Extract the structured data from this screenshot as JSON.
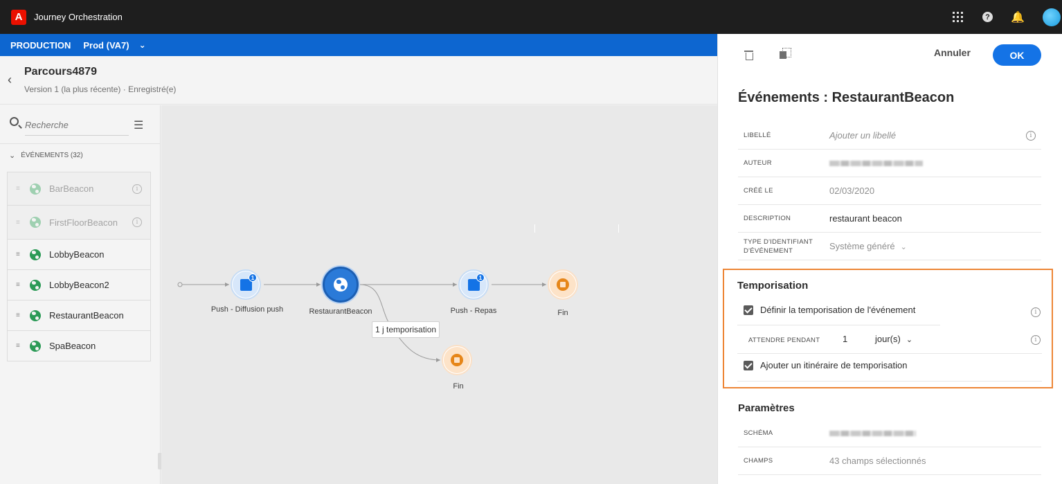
{
  "app": {
    "title": "Journey Orchestration",
    "logo_letter": "A"
  },
  "env": {
    "label": "PRODUCTION",
    "sandbox": "Prod (VA7)"
  },
  "journey": {
    "name": "Parcours4879",
    "subtitle": "Version 1 (la plus récente) · Enregistré(e)"
  },
  "left": {
    "search_placeholder": "Recherche",
    "category": "ÉVÉNEMENTS (32)",
    "events": [
      {
        "label": "BarBeacon",
        "disabled": true
      },
      {
        "label": "FirstFloorBeacon",
        "disabled": true
      },
      {
        "label": "LobbyBeacon",
        "disabled": false
      },
      {
        "label": "LobbyBeacon2",
        "disabled": false
      },
      {
        "label": "RestaurantBeacon",
        "disabled": false
      },
      {
        "label": "SpaBeacon",
        "disabled": false
      }
    ]
  },
  "canvas": {
    "nodes": {
      "push1": "Push - Diffusion push",
      "event": "RestaurantBeacon",
      "push2": "Push - Repas",
      "end1": "Fin",
      "end2": "Fin"
    },
    "badge": "1",
    "timeout_tag": "1 j temporisation"
  },
  "panel": {
    "cancel": "Annuler",
    "ok": "OK",
    "title": "Événements : RestaurantBeacon",
    "props": {
      "label_key": "LIBELLÉ",
      "label_val": "Ajouter un libellé",
      "author_key": "AUTEUR",
      "created_key": "CRÉÉ LE",
      "created_val": "02/03/2020",
      "desc_key": "DESCRIPTION",
      "desc_val": "restaurant beacon",
      "idtype_key": "TYPE D'IDENTIFIANT D'ÉVÉNEMENT",
      "idtype_val": "Système généré"
    },
    "timeout": {
      "title": "Temporisation",
      "define_label": "Définir la temporisation de l'événement",
      "wait_key": "ATTENDRE PENDANT",
      "wait_value": "1",
      "wait_unit": "jour(s)",
      "path_label": "Ajouter un itinéraire de temporisation"
    },
    "params": {
      "title": "Paramètres",
      "schema_key": "SCHÉMA",
      "fields_key": "CHAMPS",
      "fields_val": "43 champs sélectionnés"
    }
  },
  "colors": {
    "accent": "#1473e6",
    "env_bar": "#0d66d0",
    "highlight": "#ed8535",
    "end_node": "#e68619"
  }
}
